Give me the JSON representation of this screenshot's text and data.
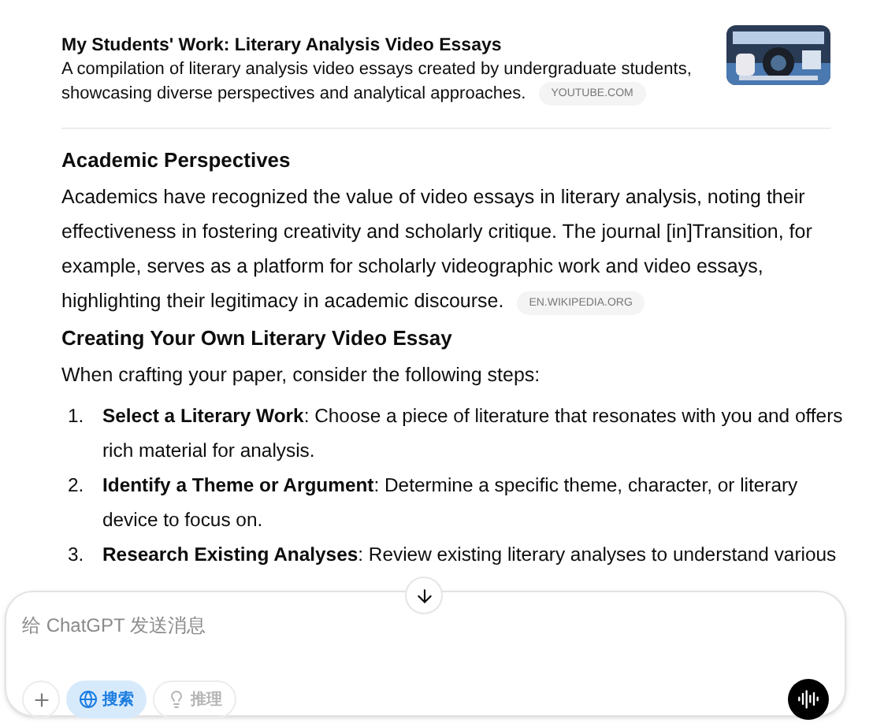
{
  "source_card": {
    "title": "My Students' Work: Literary Analysis Video Essays",
    "description": "A compilation of literary analysis video essays created by undergraduate students, showcasing diverse perspectives and analytical approaches.",
    "source": "YOUTUBE.COM"
  },
  "sections": [
    {
      "heading": "Academic Perspectives",
      "paragraph": "Academics have recognized the value of video essays in literary analysis, noting their effectiveness in fostering creativity and scholarly critique. The journal [in]Transition, for example, serves as a platform for scholarly videographic work and video essays, highlighting their legitimacy in academic discourse.",
      "source": "EN.WIKIPEDIA.ORG"
    },
    {
      "heading": "Creating Your Own Literary Video Essay",
      "paragraph": "When crafting your paper, consider the following steps:",
      "steps": [
        {
          "number": "1.",
          "text": "**Select a Literary Work**: Choose a piece of literature that resonates with you and offers rich material for analysis."
        },
        {
          "number": "2.",
          "text": "**Identify a Theme or Argument**: Determine a specific theme, character, or literary device to focus on."
        },
        {
          "number": "3.",
          "text": "**Research Existing Analyses**: Review existing literary analyses to understand various"
        }
      ]
    }
  ],
  "composer": {
    "placeholder": "给 ChatGPT 发送消息",
    "tools": [
      {
        "label": "搜索",
        "kind": "search",
        "selected": true
      },
      {
        "label": "推理",
        "kind": "reason",
        "selected": false
      }
    ]
  }
}
